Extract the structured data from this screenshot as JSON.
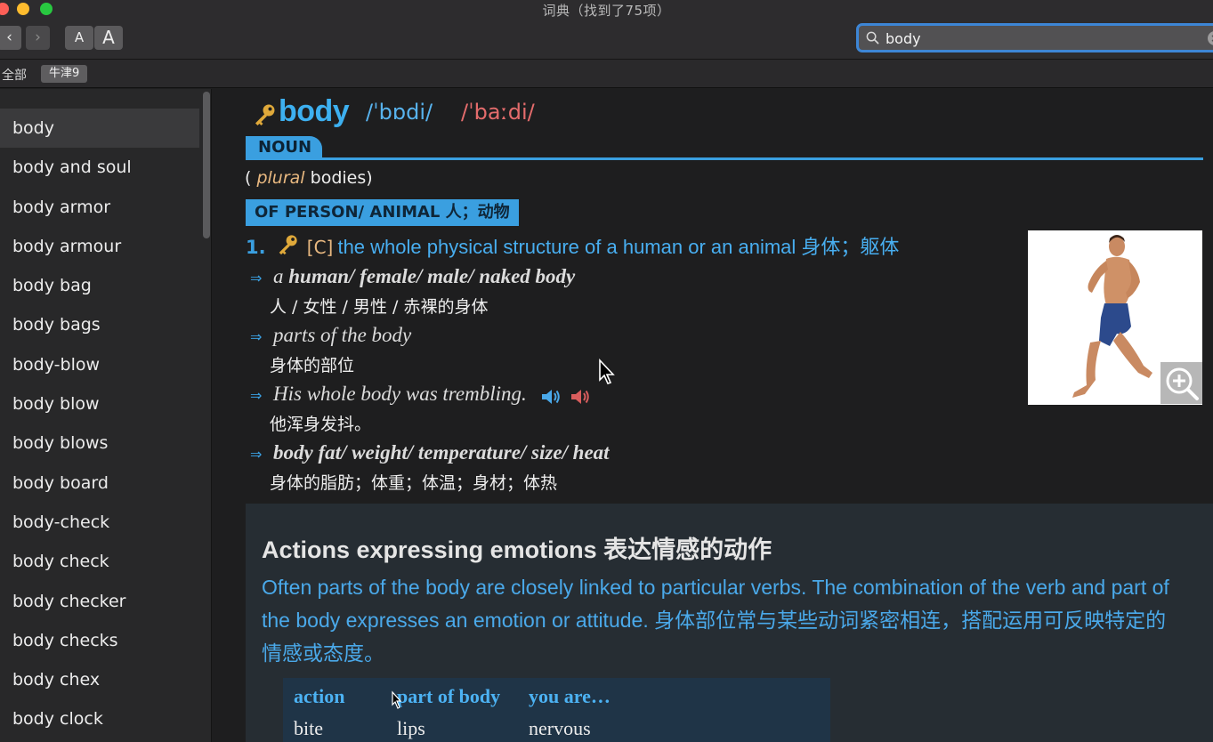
{
  "window": {
    "title": "词典（找到了75项）"
  },
  "toolbar": {
    "back_label": "‹",
    "forward_label": "›",
    "font_smaller_label": "A",
    "font_larger_label": "A"
  },
  "search": {
    "value": "body",
    "clear_label": "×"
  },
  "filter": {
    "all_label": "全部",
    "dict_tag": "牛津9"
  },
  "sidebar": {
    "items": [
      "body",
      "body and soul",
      "body armor",
      "body armour",
      "body bag",
      "body bags",
      "body-blow",
      "body blow",
      "body blows",
      "body board",
      "body-check",
      "body check",
      "body checker",
      "body checks",
      "body chex",
      "body clock"
    ],
    "selected_index": 0
  },
  "entry": {
    "headword": "body",
    "pron_br": "/ˈbɒdi/",
    "pron_am": "/ˈbaːdi/",
    "pos": "NOUN",
    "plural_open": "(",
    "plural_label": "plural",
    "plural_form": "bodies)",
    "sense_tag": "OF PERSON/ ANIMAL 人；动物",
    "sense_num": "1.",
    "sense_gram": "[C]",
    "sense_def": "the whole physical structure of a human or an animal 身体；躯体",
    "examples": [
      {
        "pre": "a ",
        "en": "human/ female/ male/ naked body",
        "bold": true,
        "zh": "人 / 女性 / 男性 / 赤裸的身体"
      },
      {
        "pre": "",
        "en": "parts of the body",
        "bold": false,
        "zh": "身体的部位"
      },
      {
        "pre": "",
        "en": "His whole body was trembling.",
        "bold": false,
        "zh": "他浑身发抖。"
      },
      {
        "pre": "",
        "en": "body fat/ weight/ temperature/ size/ heat",
        "bold": true,
        "zh": "身体的脂肪；体重；体温；身材；体热"
      }
    ],
    "example_arrow": "⇒"
  },
  "usage": {
    "title": "Actions expressing emotions 表达情感的动作",
    "text": "Often parts of the body are closely linked to particular verbs. The combination of the verb and part of the body expresses an emotion or attitude. 身体部位常与某些动词紧密相连，搭配运用可反映特定的情感或态度。",
    "table": {
      "headers": [
        "action",
        "part of body",
        "you are…"
      ],
      "rows": [
        [
          "bite",
          "lips",
          "nervous"
        ]
      ]
    }
  },
  "colors": {
    "accent": "#3a9fe0",
    "headword": "#3db0f0",
    "pron_am": "#e46c6c",
    "grammar": "#e8b880",
    "background": "#1e1e1f"
  },
  "icons": [
    "search-icon",
    "clear-icon",
    "key-icon",
    "speaker-br-icon",
    "speaker-am-icon",
    "zoom-in-icon",
    "back-icon",
    "forward-icon"
  ]
}
